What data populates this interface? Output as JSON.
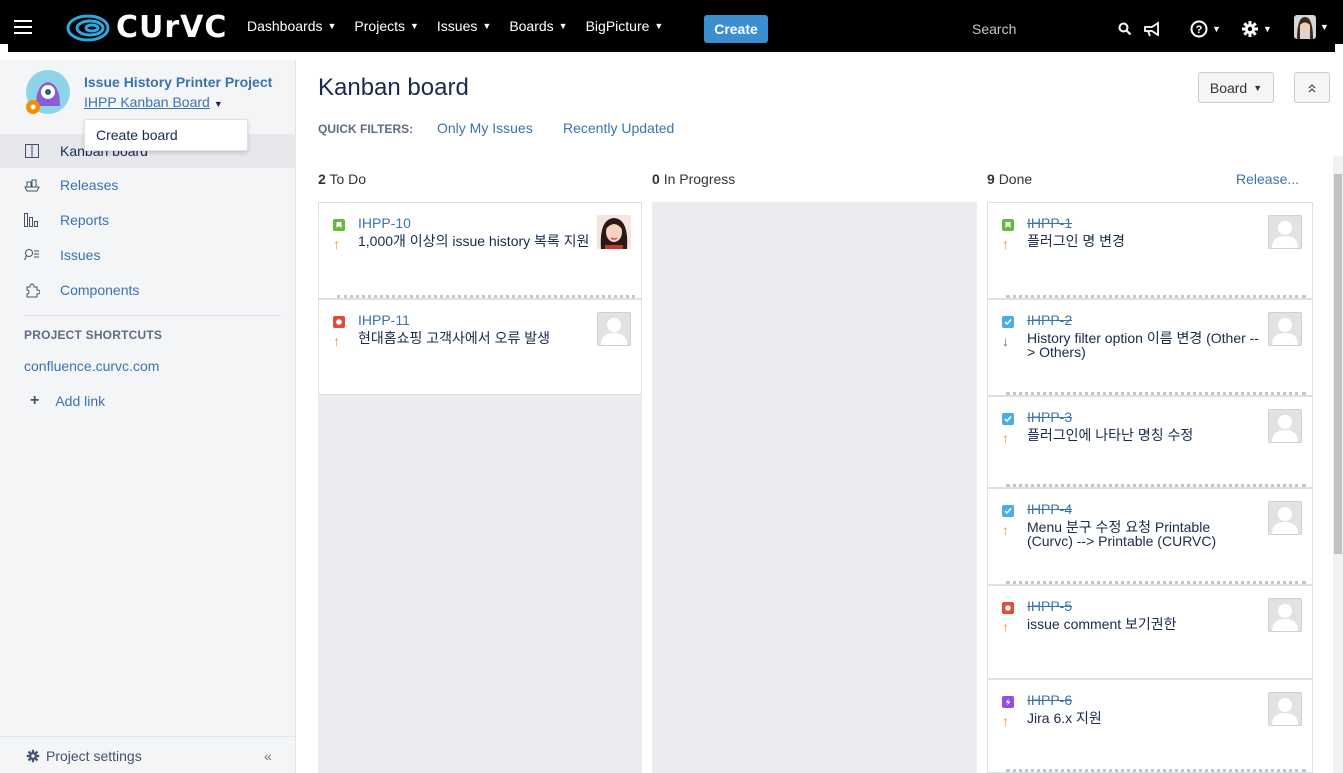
{
  "topnav": {
    "logo_text": "CUrVC",
    "items": [
      {
        "label": "Dashboards"
      },
      {
        "label": "Projects"
      },
      {
        "label": "Issues"
      },
      {
        "label": "Boards"
      },
      {
        "label": "BigPicture"
      }
    ],
    "create_label": "Create",
    "search_placeholder": "Search",
    "icons": [
      "menu-icon",
      "search-icon",
      "feedback-megaphone-icon",
      "help-icon",
      "settings-gear-icon",
      "user-avatar"
    ]
  },
  "sidebar": {
    "project_name": "Issue History Printer Project",
    "board_name": "IHPP Kanban Board",
    "dropdown_item": "Create board",
    "items": [
      {
        "label": "Kanban board",
        "icon": "board-icon",
        "active": true
      },
      {
        "label": "Releases",
        "icon": "ship-icon"
      },
      {
        "label": "Reports",
        "icon": "reports-icon"
      },
      {
        "label": "Issues",
        "icon": "issues-search-icon"
      },
      {
        "label": "Components",
        "icon": "puzzle-icon"
      }
    ],
    "shortcuts_title": "PROJECT SHORTCUTS",
    "shortcut_link": "confluence.curvc.com",
    "add_link": "Add link",
    "settings_label": "Project settings",
    "collapse_label": "«"
  },
  "main": {
    "title": "Kanban board",
    "board_button": "Board",
    "quick_filters_label": "QUICK FILTERS:",
    "quick_filters": [
      "Only My Issues",
      "Recently Updated"
    ],
    "columns": [
      {
        "count": "2",
        "name": "To Do"
      },
      {
        "count": "0",
        "name": "In Progress"
      },
      {
        "count": "9",
        "name": "Done"
      }
    ],
    "release_link": "Release...",
    "todo_cards": [
      {
        "key": "IHPP-10",
        "summary": "1,000개 이상의 issue history 복록 지원",
        "type": "story",
        "priority": "up",
        "assignee": "photo"
      },
      {
        "key": "IHPP-11",
        "summary": "현대홈쇼핑 고객사에서 오류 발생",
        "type": "bug",
        "priority": "up",
        "assignee": "placeholder"
      }
    ],
    "done_cards": [
      {
        "key": "IHPP-1",
        "summary": "플러그인 명 변경",
        "type": "story",
        "priority": "up"
      },
      {
        "key": "IHPP-2",
        "summary": "History filter option 이름 변경 (Other --> Others)",
        "type": "task",
        "priority": "down"
      },
      {
        "key": "IHPP-3",
        "summary": "플러그인에 나타난 명칭 수정",
        "type": "task",
        "priority": "up"
      },
      {
        "key": "IHPP-4",
        "summary": "Menu 분구 수정 요청 Printable (Curvc) --> Printable (CURVC)",
        "type": "task",
        "priority": "up"
      },
      {
        "key": "IHPP-5",
        "summary": "issue comment 보기권한",
        "type": "bug",
        "priority": "up"
      },
      {
        "key": "IHPP-6",
        "summary": "Jira 6.x 지원",
        "type": "epic",
        "priority": "up"
      }
    ]
  },
  "colors": {
    "link": "#3b73af",
    "create": "#3b8fd0",
    "story": "#63ba3c",
    "bug": "#e5493a",
    "task": "#4bade8",
    "epic": "#904ee2",
    "prio_up": "#f79232",
    "prio_down": "#3f8f3f"
  }
}
